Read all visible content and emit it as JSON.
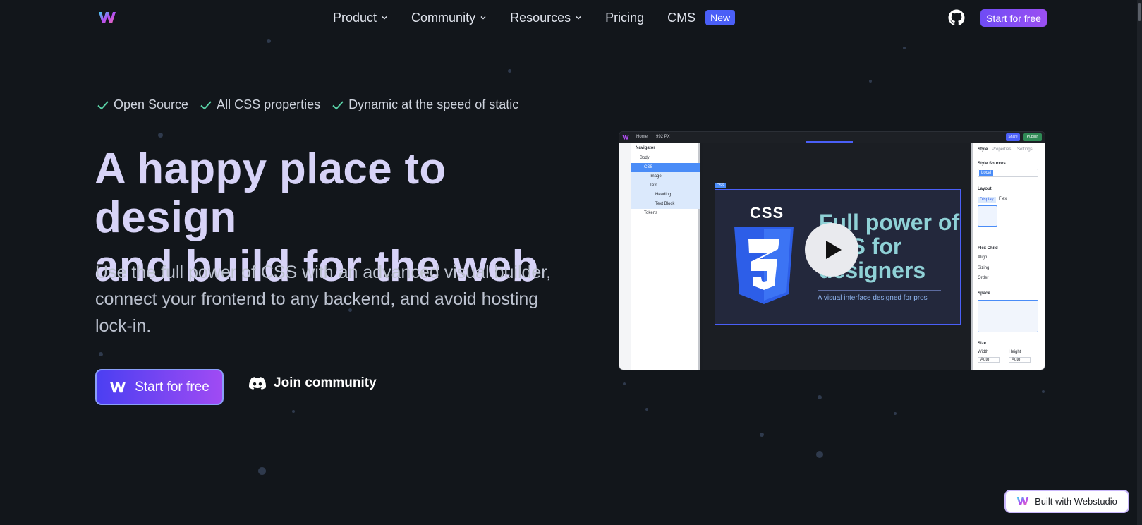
{
  "nav": {
    "menu": [
      {
        "label": "Product",
        "has_dropdown": true
      },
      {
        "label": "Community",
        "has_dropdown": true
      },
      {
        "label": "Resources",
        "has_dropdown": true
      },
      {
        "label": "Pricing",
        "has_dropdown": false
      },
      {
        "label": "CMS",
        "has_dropdown": false
      }
    ],
    "cms_badge": "New",
    "cta_label": "Start for free",
    "github_icon": "github-icon",
    "logo_icon": "webstudio-logo-icon"
  },
  "features": [
    {
      "label": "Open Source"
    },
    {
      "label": "All CSS properties"
    },
    {
      "label": "Dynamic at the speed of static"
    }
  ],
  "hero": {
    "title_line1": "A happy place to design",
    "title_line2": "and build for the web",
    "subtitle": "Use the full power of CSS with an advanced visual builder, connect your frontend to any backend, and avoid hosting lock-in.",
    "primary_cta": "Start for free",
    "secondary_cta": "Join community",
    "secondary_icon": "discord-icon"
  },
  "editor_preview": {
    "top_home": "Home",
    "top_size": "992 PX",
    "share": "Share",
    "publish": "Publish",
    "navigator": {
      "title": "Navigator",
      "items": [
        "Body",
        "CSS",
        "Image",
        "Text",
        "Heading",
        "Text Block",
        "Tokens"
      ]
    },
    "right_panel": {
      "tabs": [
        "Style",
        "Properties",
        "Settings"
      ],
      "style_sources": "Style Sources",
      "local": "Local",
      "layout": "Layout",
      "display": "Display",
      "display_value": "Flex",
      "flex_child": "Flex Child",
      "align": "Align",
      "sizing": "Sizing",
      "order": "Order",
      "space": "Space",
      "size": "Size",
      "width": "Width",
      "height": "Height",
      "auto": "Auto"
    },
    "canvas": {
      "css_label": "CSS",
      "badge_logo_text": "CSS",
      "title": "Full power of CSS for designers",
      "subtitle": "A visual interface designed for pros"
    }
  },
  "footer_badge": "Built with Webstudio",
  "colors": {
    "background": "#12161b",
    "accent": "#4a5ff7",
    "gradient_start": "#4b3ff2",
    "gradient_end": "#a04bf3",
    "check": "#59d1a6"
  }
}
